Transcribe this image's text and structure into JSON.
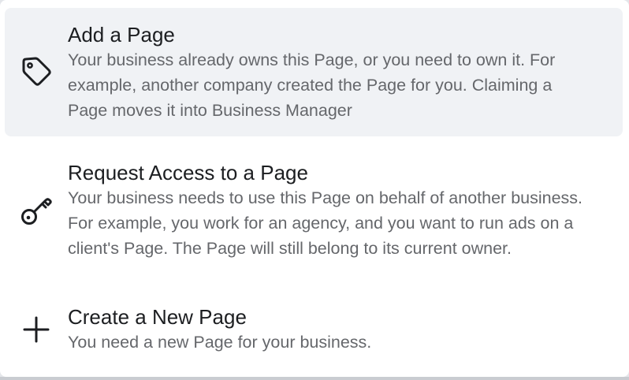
{
  "menu": {
    "items": [
      {
        "title": "Add a Page",
        "description": "Your business already owns this Page, or you need to own it. For example, another company created the Page for you. Claiming a Page moves it into Business Manager",
        "icon": "tag-icon"
      },
      {
        "title": "Request Access to a Page",
        "description": "Your business needs to use this Page on behalf of another business. For example, you work for an agency, and you want to run ads on a client's Page. The Page will still belong to its current owner.",
        "icon": "key-icon"
      },
      {
        "title": "Create a New Page",
        "description": "You need a new Page for your business.",
        "icon": "plus-icon"
      }
    ]
  },
  "colors": {
    "highlight": "#f0f2f5",
    "title": "#1c1e21",
    "description": "#65676b"
  }
}
